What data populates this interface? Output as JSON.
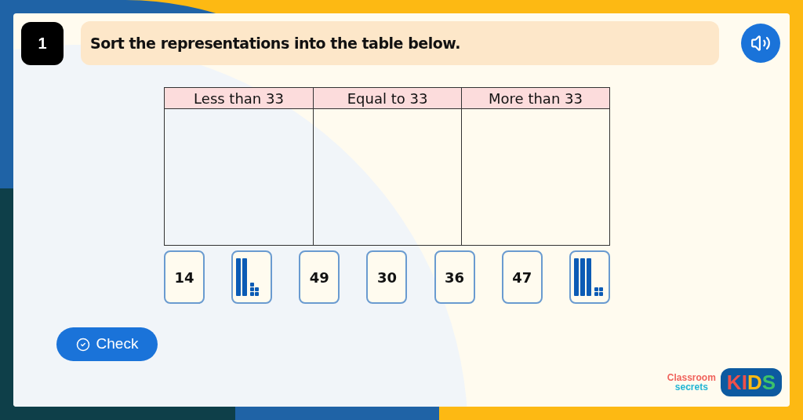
{
  "question": {
    "number": "1",
    "prompt": "Sort the representations into the table below."
  },
  "table": {
    "columns": [
      "Less than 33",
      "Equal to 33",
      "More than 33"
    ]
  },
  "cards": [
    {
      "kind": "number",
      "text": "14"
    },
    {
      "kind": "blocks",
      "blocks": [
        {
          "kind": "ten"
        },
        {
          "kind": "ten"
        },
        {
          "kind": "one"
        },
        {
          "kind": "one"
        },
        {
          "kind": "one"
        },
        {
          "kind": "one"
        },
        {
          "kind": "one"
        }
      ]
    },
    {
      "kind": "number",
      "text": "49"
    },
    {
      "kind": "number",
      "text": "30"
    },
    {
      "kind": "number",
      "text": "36"
    },
    {
      "kind": "number",
      "text": "47"
    },
    {
      "kind": "blocks",
      "blocks": [
        {
          "kind": "ten"
        },
        {
          "kind": "ten"
        },
        {
          "kind": "ten"
        },
        {
          "kind": "one"
        },
        {
          "kind": "one"
        },
        {
          "kind": "one"
        },
        {
          "kind": "one"
        }
      ]
    }
  ],
  "check_button": {
    "label": "Check"
  },
  "logo": {
    "line_1": "Classroom",
    "line_2": "secrets",
    "badge_letters": [
      "K",
      "I",
      "D",
      "S"
    ]
  }
}
